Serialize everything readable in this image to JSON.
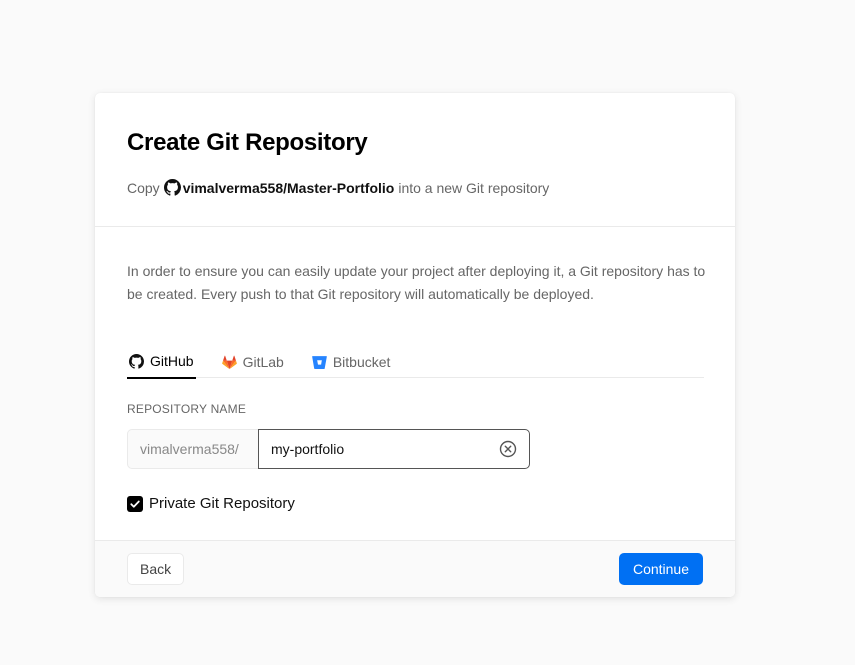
{
  "dialog": {
    "title": "Create Git Repository",
    "subtitle_prefix": "Copy",
    "source_repo": "vimalverma558/Master-Portfolio",
    "subtitle_suffix": "into a new Git repository",
    "description": "In order to ensure you can easily update your project after deploying it, a Git repository has to be created. Every push to that Git repository will automatically be deployed."
  },
  "tabs": [
    {
      "label": "GitHub",
      "icon": "github-icon",
      "active": true
    },
    {
      "label": "GitLab",
      "icon": "gitlab-icon",
      "active": false
    },
    {
      "label": "Bitbucket",
      "icon": "bitbucket-icon",
      "active": false
    }
  ],
  "repository": {
    "label": "REPOSITORY NAME",
    "prefix": "vimalverma558/",
    "value": "my-portfolio"
  },
  "private_checkbox": {
    "label": "Private Git Repository",
    "checked": true
  },
  "footer": {
    "back_label": "Back",
    "continue_label": "Continue"
  },
  "colors": {
    "accent": "#0070f3",
    "gitlab": "#e24329",
    "bitbucket": "#2684ff"
  }
}
